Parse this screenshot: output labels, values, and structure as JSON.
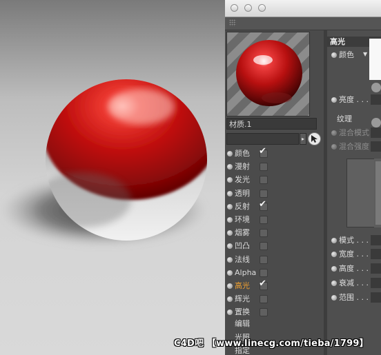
{
  "material_editor": {
    "material_name": "材质.1",
    "channels": [
      {
        "label": "颜色",
        "checked": true,
        "active": false
      },
      {
        "label": "漫射",
        "checked": false,
        "active": false
      },
      {
        "label": "发光",
        "checked": false,
        "active": false
      },
      {
        "label": "透明",
        "checked": false,
        "active": false
      },
      {
        "label": "反射",
        "checked": true,
        "active": false
      },
      {
        "label": "环境",
        "checked": false,
        "active": false
      },
      {
        "label": "烟雾",
        "checked": false,
        "active": false
      },
      {
        "label": "凹凸",
        "checked": false,
        "active": false
      },
      {
        "label": "法线",
        "checked": false,
        "active": false
      },
      {
        "label": "Alpha",
        "checked": false,
        "active": false
      },
      {
        "label": "高光",
        "checked": true,
        "active": true
      },
      {
        "label": "辉光",
        "checked": false,
        "active": false
      },
      {
        "label": "置换",
        "checked": false,
        "active": false
      }
    ],
    "commands": [
      "编辑",
      "光照",
      "指定"
    ],
    "specular_panel": {
      "section_title": "高光",
      "color_label": "颜色",
      "brightness_label": "亮度 . . .",
      "texture_label": "纹理",
      "blend_mode_label": "混合模式",
      "blend_strength_label": "混合强度",
      "params": [
        {
          "label": "模式 . . ."
        },
        {
          "label": "宽度 . . ."
        },
        {
          "label": "高度 . . ."
        },
        {
          "label": "衰减 . . ."
        },
        {
          "label": "范围 . . ."
        }
      ]
    }
  },
  "watermark": "C4D吧 【www.linecg.com/tieba/1799】",
  "icons": {
    "eyedropper": "eyedropper-icon",
    "dropdown": "dropdown-arrow-icon",
    "grip": "grip-icon",
    "window_close": "close-icon",
    "window_minimize": "minimize-icon",
    "window_zoom": "zoom-icon"
  },
  "colors": {
    "sphere_red": "#c8181a",
    "active_channel": "#f0a030",
    "panel_bg": "#4a4a4a"
  }
}
